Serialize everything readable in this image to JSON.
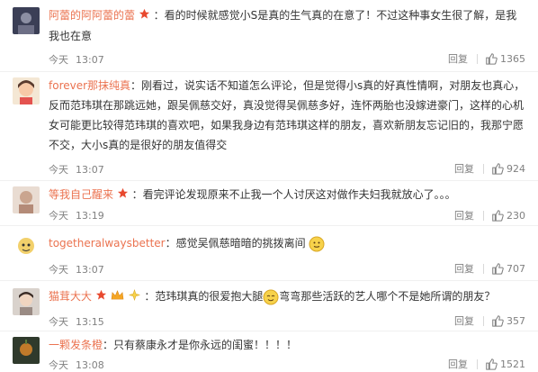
{
  "comments": [
    {
      "username": "阿蕾的阿阿蕾的蕾",
      "text": "：看的时候就感觉小S是真的生气真的在意了！不过这种事女生很了解，是我我也在意",
      "date": "今天",
      "time": "13:07",
      "reply_label": "回复",
      "likes": "1365"
    },
    {
      "username": "forever那抹纯真",
      "text": "：刚看过，说实话不知道怎么评论，但是觉得小s真的好真性情啊，对朋友也真心，反而范玮琪在那跳远她，跟吴佩慈交好，真没觉得吴佩慈多好，连怀两胎也没嫁进豪门，这样的心机女可能更比较得范玮琪的喜欢吧，如果我身边有范玮琪这样的朋友，喜欢新朋友忘记旧的，我那宁愿不交，大小s真的是很好的朋友值得交",
      "date": "今天",
      "time": "13:07",
      "reply_label": "回复",
      "likes": "924"
    },
    {
      "username": "等我自己醒来",
      "text": "：看完评论发现原来不止我一个人讨厌这对做作夫妇我就放心了。。。",
      "date": "今天",
      "time": "13:19",
      "reply_label": "回复",
      "likes": "230"
    },
    {
      "username": "togetheralwaysbetter",
      "text": "：感觉吴佩慈暗暗的挑拨离间",
      "date": "今天",
      "time": "13:07",
      "reply_label": "回复",
      "likes": "707"
    },
    {
      "username": "猫茸大大",
      "text_a": "：范玮琪真的很爱抱大腿",
      "text_b": "弯弯那些活跃的艺人哪个不是她所谓的朋友？",
      "date": "今天",
      "time": "13:15",
      "reply_label": "回复",
      "likes": "357"
    },
    {
      "username": "一颗发条橙",
      "text": "：只有蔡康永才是你永远的闺蜜！！！！",
      "date": "今天",
      "time": "13:08",
      "reply_label": "回复",
      "likes": "1521"
    }
  ],
  "colors": {
    "username": "#eb7350",
    "meta": "#808080",
    "text": "#333333",
    "badge": "#f5a623"
  },
  "icons": {
    "like": "thumbs-up-icon",
    "member_badge": "star-badge-icon",
    "emoji": "smile-emoji-icon"
  }
}
